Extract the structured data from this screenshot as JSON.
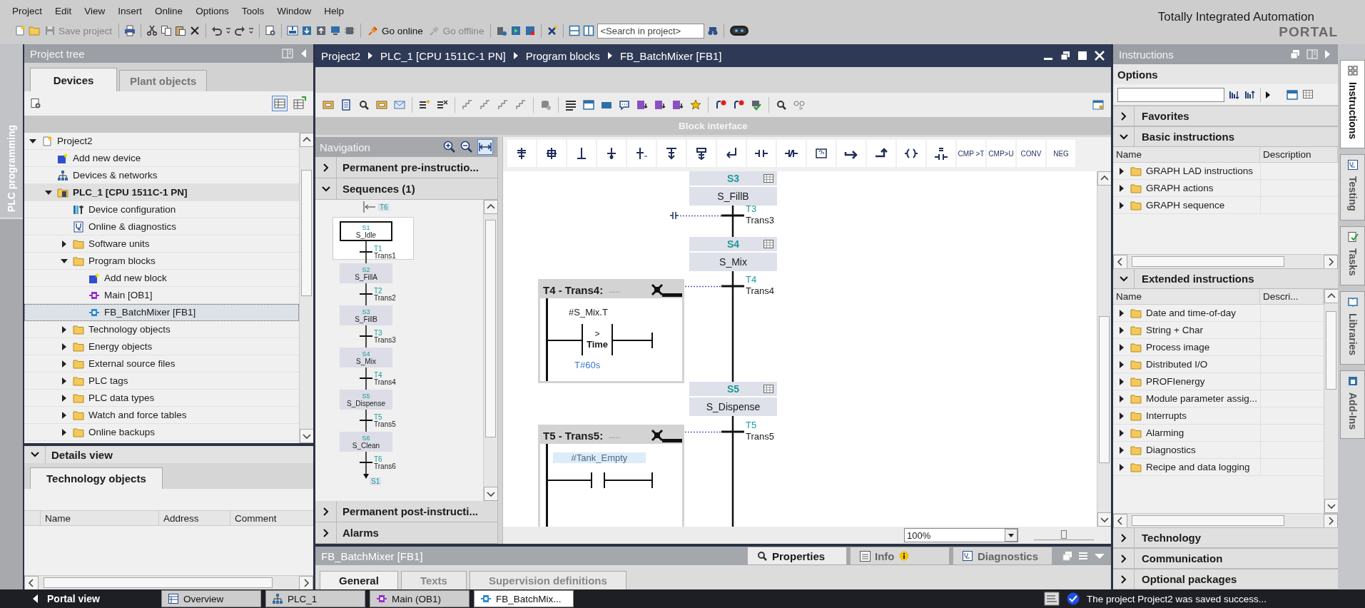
{
  "menu": [
    "Project",
    "Edit",
    "View",
    "Insert",
    "Online",
    "Options",
    "Tools",
    "Window",
    "Help"
  ],
  "toolbar": {
    "buttons": [
      {
        "label": "Save project",
        "kind": "save",
        "disabled": true
      },
      {
        "label": "Go online",
        "kind": "online",
        "disabled": false
      },
      {
        "label": "Go offline",
        "kind": "offline",
        "disabled": true
      }
    ],
    "search_placeholder": "<Search in project>"
  },
  "brand": {
    "title": "Totally Integrated Automation",
    "subtitle": "PORTAL"
  },
  "side_tab": "PLC programming",
  "project_tree": {
    "title": "Project tree",
    "tabs": [
      {
        "label": "Devices",
        "selected": true
      },
      {
        "label": "Plant objects",
        "selected": false
      }
    ],
    "items": [
      {
        "label": "Project2",
        "kind": "project",
        "expanded": true,
        "selected": false,
        "children": [
          {
            "label": "Add new device",
            "kind": "add",
            "selected": false
          },
          {
            "label": "Devices & networks",
            "kind": "network",
            "selected": false
          },
          {
            "label": "PLC_1 [CPU 1511C-1 PN]",
            "kind": "device",
            "expanded": true,
            "selected": false,
            "children": [
              {
                "label": "Device configuration",
                "kind": "config",
                "selected": false
              },
              {
                "label": "Online & diagnostics",
                "kind": "diagnostics",
                "selected": false
              },
              {
                "label": "Software units",
                "kind": "folder",
                "expanded": false,
                "selected": false
              },
              {
                "label": "Program blocks",
                "kind": "folder",
                "expanded": true,
                "selected": false,
                "children": [
                  {
                    "label": "Add new block",
                    "kind": "add",
                    "selected": false
                  },
                  {
                    "label": "Main [OB1]",
                    "kind": "ob",
                    "selected": false
                  },
                  {
                    "label": "FB_BatchMixer [FB1]",
                    "kind": "fb",
                    "selected": true
                  }
                ]
              },
              {
                "label": "Technology objects",
                "kind": "folder",
                "expanded": false,
                "selected": false
              },
              {
                "label": "Energy objects",
                "kind": "folder",
                "expanded": false,
                "selected": false
              },
              {
                "label": "External source files",
                "kind": "folder",
                "expanded": false,
                "selected": false
              },
              {
                "label": "PLC tags",
                "kind": "folder",
                "expanded": false,
                "selected": false
              },
              {
                "label": "PLC data types",
                "kind": "folder",
                "expanded": false,
                "selected": false
              },
              {
                "label": "Watch and force tables",
                "kind": "folder",
                "expanded": false,
                "selected": false
              },
              {
                "label": "Online backups",
                "kind": "folder",
                "expanded": false,
                "selected": false
              }
            ]
          }
        ]
      }
    ]
  },
  "details_view": {
    "title": "Details view",
    "tabs": [
      {
        "label": "Technology objects",
        "selected": true
      }
    ],
    "columns": [
      "Name",
      "Address",
      "Comment"
    ]
  },
  "editor": {
    "breadcrumb": [
      "Project2",
      "PLC_1 [CPU 1511C-1 PN]",
      "Program blocks",
      "FB_BatchMixer [FB1]"
    ],
    "interface_label": "Block interface",
    "navigation": {
      "title": "Navigation",
      "sections": [
        {
          "label": "Permanent pre-instructio...",
          "expanded": false
        },
        {
          "label": "Sequences (1)",
          "expanded": true
        },
        {
          "label": "Permanent post-instructi...",
          "expanded": false
        },
        {
          "label": "Alarms",
          "expanded": false
        }
      ],
      "overview": {
        "entry": "T6",
        "jump": "S1",
        "steps": [
          {
            "number": "S1",
            "name": "S_Idle",
            "selected": true
          },
          {
            "number": "S2",
            "name": "S_FillA",
            "selected": false
          },
          {
            "number": "S3",
            "name": "S_FillB",
            "selected": false
          },
          {
            "number": "S4",
            "name": "S_Mix",
            "selected": false
          },
          {
            "number": "S5",
            "name": "S_Dispense",
            "selected": false
          },
          {
            "number": "S6",
            "name": "S_Clean",
            "selected": false
          }
        ],
        "transitions": [
          {
            "number": "T1",
            "name": "Trans1"
          },
          {
            "number": "T2",
            "name": "Trans2"
          },
          {
            "number": "T3",
            "name": "Trans3"
          },
          {
            "number": "T4",
            "name": "Trans4"
          },
          {
            "number": "T5",
            "name": "Trans5"
          },
          {
            "number": "T6",
            "name": "Trans6"
          }
        ]
      }
    },
    "palette": [
      "CMP >T",
      "CMP>U",
      "CONV",
      "NEG"
    ],
    "canvas": {
      "steps": [
        {
          "number": "S3",
          "name": "S_FillB"
        },
        {
          "number": "S4",
          "name": "S_Mix"
        },
        {
          "number": "S5",
          "name": "S_Dispense"
        }
      ],
      "transitions": [
        {
          "number": "T3",
          "name": "Trans3"
        },
        {
          "number": "T4",
          "name": "Trans4"
        },
        {
          "number": "T5",
          "name": "Trans5"
        }
      ],
      "networks": [
        {
          "title": "T4 - Trans4:",
          "comment": ".....",
          "kind": "compare",
          "operand": "#S_Mix.T",
          "operator": ">",
          "type": "Time",
          "value": "T#60s"
        },
        {
          "title": "T5 - Trans5:",
          "comment": ".....",
          "kind": "contact",
          "operand": "#Tank_Empty"
        }
      ]
    },
    "zoom": "100%",
    "zoom_slider": {
      "level": 0.5
    }
  },
  "properties": {
    "title": "FB_BatchMixer [FB1]",
    "tabs": [
      {
        "label": "Properties",
        "kind": "properties",
        "selected": true
      },
      {
        "label": "Info",
        "kind": "info",
        "selected": false
      },
      {
        "label": "Diagnostics",
        "kind": "diagnostics",
        "selected": false
      }
    ],
    "subtabs": [
      {
        "label": "General",
        "selected": true
      },
      {
        "label": "Texts",
        "selected": false
      },
      {
        "label": "Supervision definitions",
        "selected": false
      }
    ]
  },
  "instructions": {
    "title": "Instructions",
    "options_label": "Options",
    "sections": [
      {
        "label": "Favorites",
        "expanded": false
      },
      {
        "label": "Basic instructions",
        "expanded": true,
        "columns": [
          "Name",
          "Description"
        ],
        "rows": [
          {
            "label": "GRAPH LAD instructions",
            "expanded": false
          },
          {
            "label": "GRAPH actions",
            "expanded": false
          },
          {
            "label": "GRAPH sequence",
            "expanded": false
          }
        ]
      },
      {
        "label": "Extended instructions",
        "expanded": true,
        "columns": [
          "Name",
          "Descri..."
        ],
        "rows": [
          {
            "label": "Date and time-of-day",
            "expanded": false
          },
          {
            "label": "String + Char",
            "expanded": false
          },
          {
            "label": "Process image",
            "expanded": false
          },
          {
            "label": "Distributed I/O",
            "expanded": false
          },
          {
            "label": "PROFIenergy",
            "expanded": false
          },
          {
            "label": "Module parameter assig...",
            "expanded": false
          },
          {
            "label": "Interrupts",
            "expanded": false
          },
          {
            "label": "Alarming",
            "expanded": false
          },
          {
            "label": "Diagnostics",
            "expanded": false
          },
          {
            "label": "Recipe and data logging",
            "expanded": false
          }
        ]
      },
      {
        "label": "Technology",
        "expanded": false
      },
      {
        "label": "Communication",
        "expanded": false
      },
      {
        "label": "Optional packages",
        "expanded": false
      }
    ]
  },
  "vertical_tabs": [
    {
      "label": "Instructions",
      "selected": true
    },
    {
      "label": "Testing",
      "selected": false
    },
    {
      "label": "Tasks",
      "selected": false
    },
    {
      "label": "Libraries",
      "selected": false
    },
    {
      "label": "Add-Ins",
      "selected": false
    }
  ],
  "taskbar": {
    "portal_view": "Portal view",
    "tabs": [
      {
        "label": "Overview",
        "kind": "overview",
        "selected": false
      },
      {
        "label": "PLC_1",
        "kind": "device",
        "selected": false
      },
      {
        "label": "Main (OB1)",
        "kind": "ob",
        "selected": false
      },
      {
        "label": "FB_BatchMix...",
        "kind": "fb",
        "selected": true
      }
    ],
    "status": "The project Project2 was saved success..."
  }
}
